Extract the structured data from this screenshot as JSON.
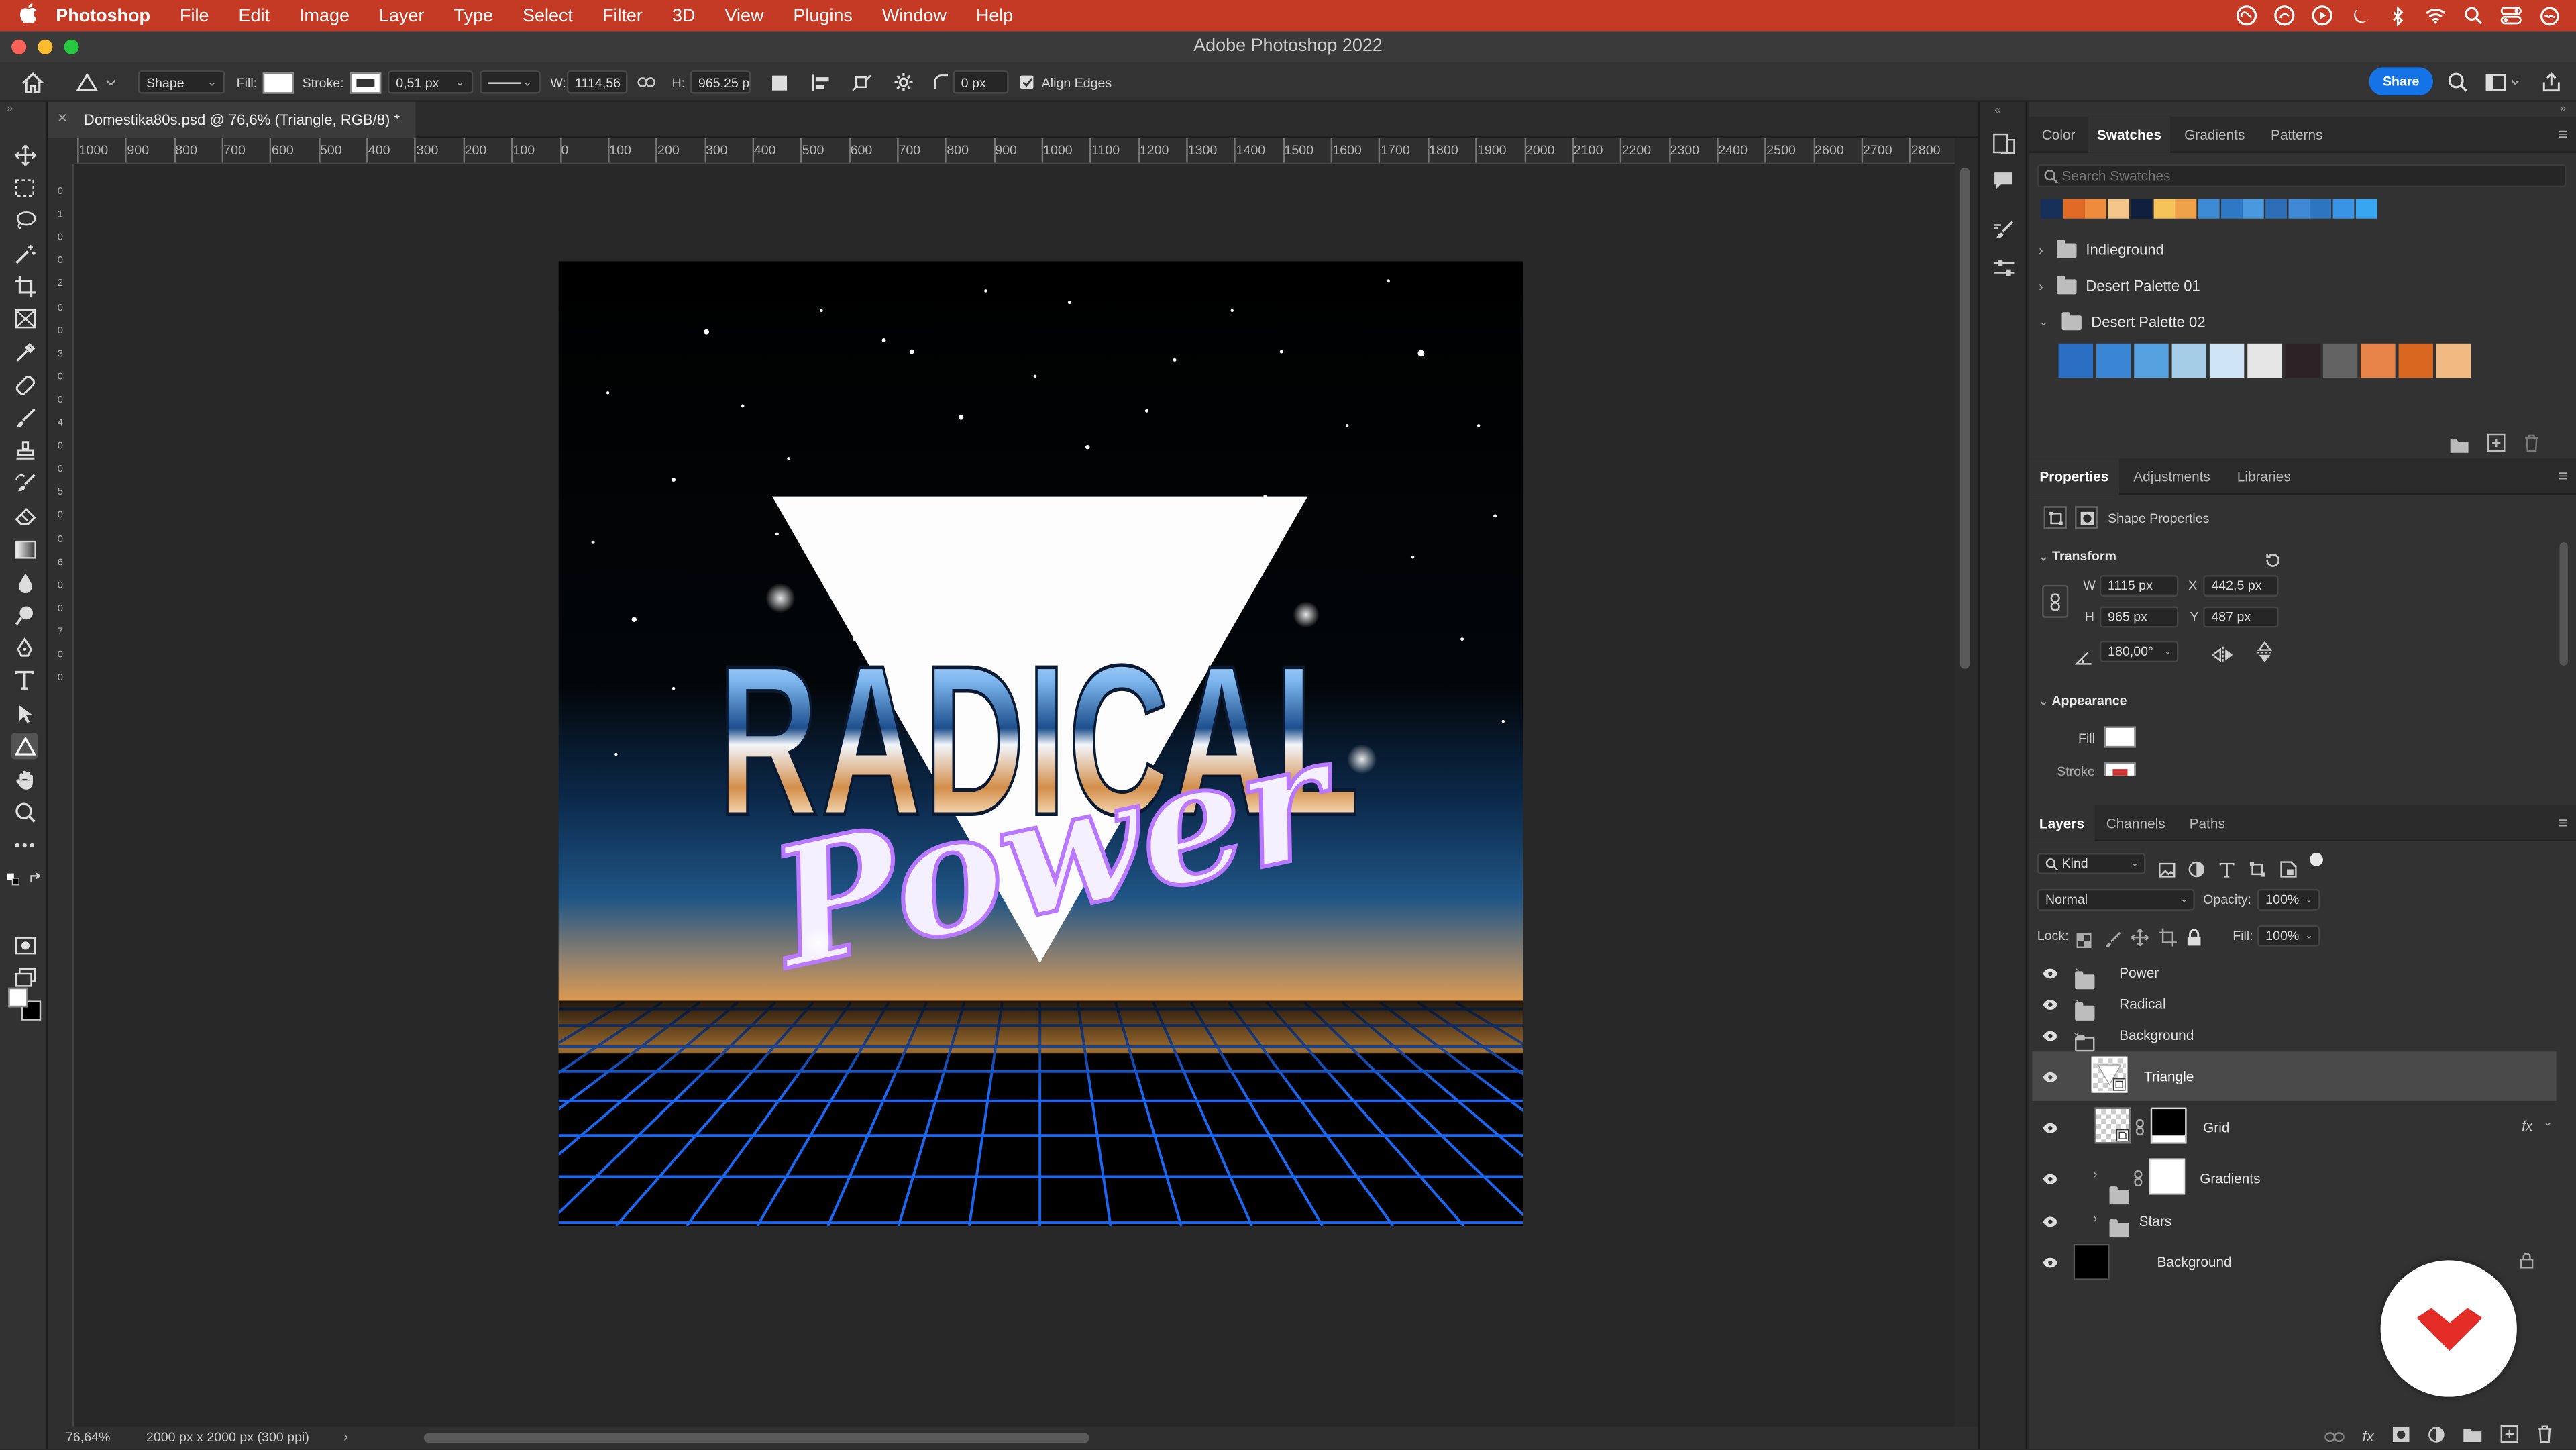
{
  "menubar": {
    "app_name": "Photoshop",
    "items": [
      "File",
      "Edit",
      "Image",
      "Layer",
      "Type",
      "Select",
      "Filter",
      "3D",
      "View",
      "Plugins",
      "Window",
      "Help"
    ]
  },
  "window": {
    "title": "Adobe Photoshop 2022"
  },
  "options": {
    "mode": "Shape",
    "fill_label": "Fill:",
    "stroke_label": "Stroke:",
    "stroke_width": "0,51 px",
    "w_label": "W:",
    "w_value": "1114,56",
    "h_label": "H:",
    "h_value": "965,25 p",
    "radius": "0 px",
    "align_edges": "Align Edges",
    "share": "Share"
  },
  "document": {
    "tab_title": "Domestika80s.psd @ 76,6% (Triangle, RGB/8) *",
    "zoom": "76,64%",
    "doc_info": "2000 px x 2000 px (300 ppi)"
  },
  "ruler": {
    "h_labels": [
      "1000",
      "900",
      "800",
      "700",
      "600",
      "500",
      "400",
      "300",
      "200",
      "100",
      "0",
      "100",
      "200",
      "300",
      "400",
      "500",
      "600",
      "700",
      "800",
      "900",
      "1000",
      "1100",
      "1200",
      "1300",
      "1400",
      "1500",
      "1600",
      "1700",
      "1800",
      "1900",
      "2000",
      "2100",
      "2200",
      "2300",
      "2400",
      "2500",
      "2600",
      "2700",
      "2800"
    ],
    "v_labels": [
      "0",
      "1",
      "0",
      "0",
      "2",
      "0",
      "0",
      "3",
      "0",
      "0",
      "4",
      "0",
      "0",
      "5",
      "0",
      "0",
      "6",
      "0",
      "0",
      "7",
      "0",
      "0"
    ]
  },
  "artwork": {
    "title_text": "RADICAL",
    "script_text": "Power"
  },
  "swatches_panel": {
    "tabs": [
      "Color",
      "Swatches",
      "Gradients",
      "Patterns"
    ],
    "active_tab": "Swatches",
    "search_placeholder": "Search Swatches",
    "recent_colors": [
      "#17305a",
      "#e06a26",
      "#ef8b3c",
      "#f3c58a",
      "#0f1f3d",
      "#f6c25a",
      "#f0a24b",
      "#3d8ad4",
      "#2f78c6",
      "#4a98dd",
      "#2c6fb8",
      "#3e88d6",
      "#2e75c0",
      "#3a94e6",
      "#39a6f2"
    ],
    "groups": [
      {
        "name": "Indieground",
        "expanded": false
      },
      {
        "name": "Desert Palette 01",
        "expanded": false
      },
      {
        "name": "Desert Palette 02",
        "expanded": true
      }
    ],
    "desert_palette_02": [
      "#2a6fc4",
      "#3a86d4",
      "#56a2e0",
      "#a5cde8",
      "#cfe4f4",
      "#e6e6e6",
      "#2b2325",
      "#636363",
      "#e8834a",
      "#d9671f",
      "#f0ba82"
    ]
  },
  "properties_panel": {
    "tabs": [
      "Properties",
      "Adjustments",
      "Libraries"
    ],
    "active_tab": "Properties",
    "heading": "Shape Properties",
    "transform_label": "Transform",
    "w_label": "W",
    "w": "1115 px",
    "x_label": "X",
    "x": "442,5 px",
    "h_label": "H",
    "h": "965 px",
    "y_label": "Y",
    "y": "487 px",
    "angle": "180,00°",
    "appearance_label": "Appearance",
    "fill_label": "Fill",
    "stroke_label": "Stroke"
  },
  "layers_panel": {
    "tabs": [
      "Layers",
      "Channels",
      "Paths"
    ],
    "active_tab": "Layers",
    "filter": "Kind",
    "blend_mode": "Normal",
    "opacity_label": "Opacity:",
    "opacity": "100%",
    "lock_label": "Lock:",
    "fill_label": "Fill:",
    "fill": "100%",
    "layers": [
      {
        "name": "Power",
        "type": "group",
        "indent": 0,
        "selected": false
      },
      {
        "name": "Radical",
        "type": "group",
        "indent": 0,
        "selected": false
      },
      {
        "name": "Background",
        "type": "group-open",
        "indent": 0,
        "selected": false
      },
      {
        "name": "Triangle",
        "type": "shape",
        "indent": 1,
        "selected": true
      },
      {
        "name": "Grid",
        "type": "smart-masked",
        "indent": 1,
        "selected": false,
        "fx": "fx"
      },
      {
        "name": "Gradients",
        "type": "group-masked",
        "indent": 1,
        "selected": false
      },
      {
        "name": "Stars",
        "type": "group",
        "indent": 1,
        "selected": false
      },
      {
        "name": "Background",
        "type": "locked",
        "indent": 0,
        "selected": false
      }
    ]
  },
  "colors": {
    "menubar_bg": "#c53a24",
    "accent": "#1473e6",
    "panel_bg": "#323232",
    "selected_row": "#4a4a4a",
    "domestika_red": "#e52d27"
  }
}
